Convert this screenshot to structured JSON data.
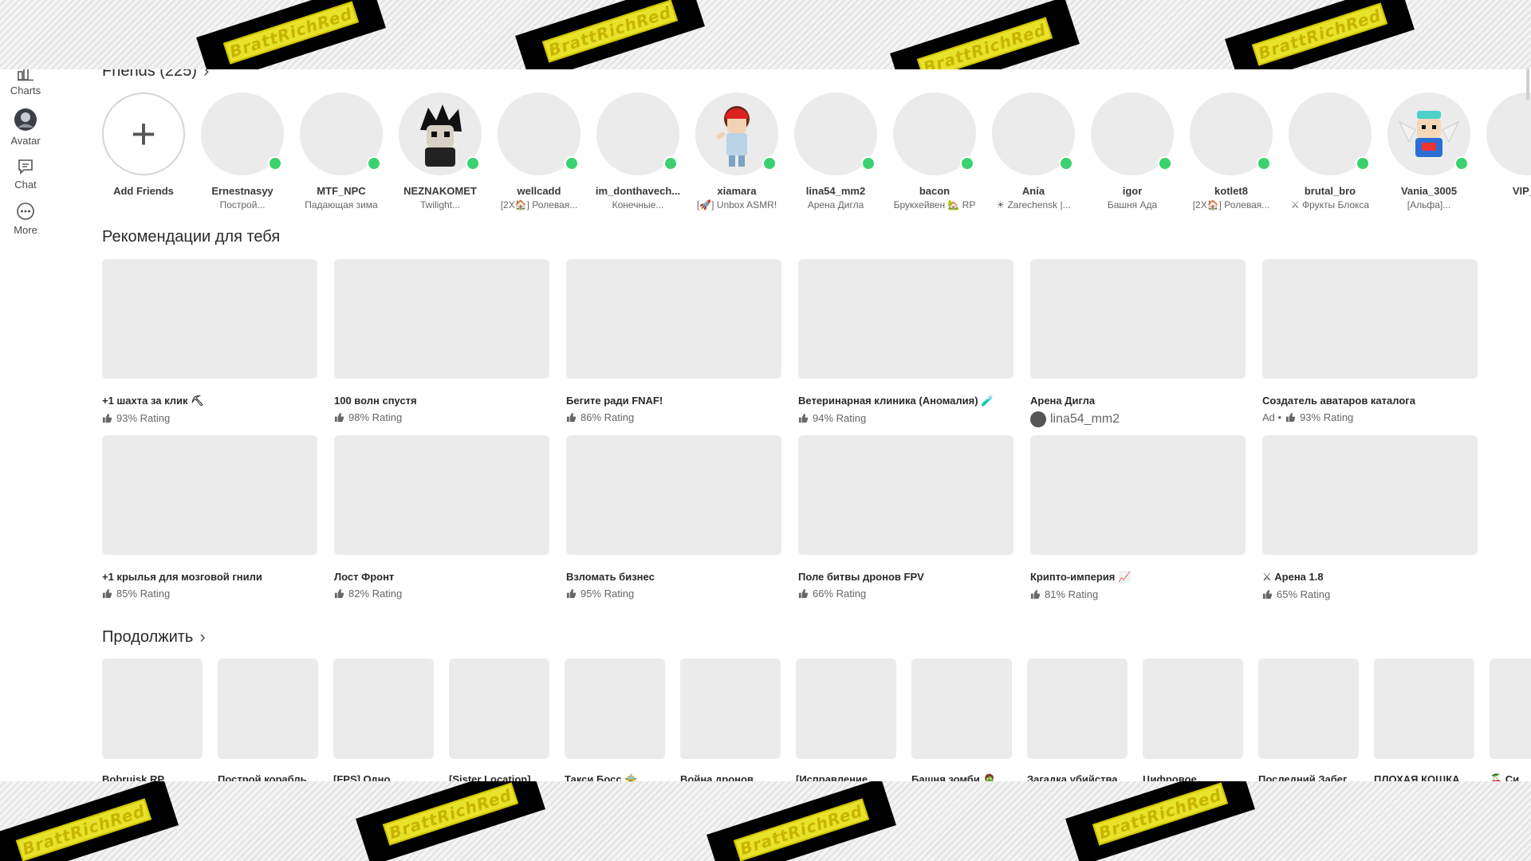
{
  "sidebar": {
    "items": [
      {
        "label": "Charts",
        "icon": "charts-icon"
      },
      {
        "label": "Avatar",
        "icon": "avatar-icon"
      },
      {
        "label": "Chat",
        "icon": "chat-icon"
      },
      {
        "label": "More",
        "icon": "more-icon"
      }
    ]
  },
  "friends": {
    "title": "Friends (225)",
    "add_label": "Add Friends",
    "list": [
      {
        "name": "Ernestnasyy",
        "status": "Построй..."
      },
      {
        "name": "MTF_NPC",
        "status": "Падающая зима"
      },
      {
        "name": "NEZNAKOMET",
        "status": "Twilight..."
      },
      {
        "name": "wellcadd",
        "status": "[2X🏠] Ролевая..."
      },
      {
        "name": "im_donthavech...",
        "status": "Конечные..."
      },
      {
        "name": "xiamara",
        "status": "[🚀] Unbox ASMR!"
      },
      {
        "name": "lina54_mm2",
        "status": "Арена Дигла"
      },
      {
        "name": "bacon",
        "status": "Брукхейвен 🏡 RP"
      },
      {
        "name": "Ania",
        "status": "☀ Zarechensk |..."
      },
      {
        "name": "igor",
        "status": "Башня Ада"
      },
      {
        "name": "kotlet8",
        "status": "[2X🏠] Ролевая..."
      },
      {
        "name": "brutal_bro",
        "status": "⚔ Фрукты Блокса"
      },
      {
        "name": "Vania_3005",
        "status": "[Альфа]..."
      },
      {
        "name": "VIP_G",
        "status": ""
      }
    ]
  },
  "recommended": {
    "title": "Рекомендации для тебя",
    "rows": [
      [
        {
          "title": "+1 шахта за клик ⛏",
          "rating": "93% Rating"
        },
        {
          "title": "100 волн спустя",
          "rating": "98% Rating"
        },
        {
          "title": "Бегите ради FNAF!",
          "rating": "86% Rating"
        },
        {
          "title": "Ветеринарная клиника (Аномалия) 🧪",
          "rating": "94% Rating"
        },
        {
          "title": "Арена Дигла",
          "creator": "lina54_mm2"
        },
        {
          "title": "Создатель аватаров каталога",
          "ad": "Ad •",
          "rating": "93% Rating"
        }
      ],
      [
        {
          "title": "+1 крылья для мозговой гнили",
          "rating": "85% Rating"
        },
        {
          "title": "Лост Фронт",
          "rating": "82% Rating"
        },
        {
          "title": "Взломать бизнес",
          "rating": "95% Rating"
        },
        {
          "title": "Поле битвы дронов FPV",
          "rating": "66% Rating"
        },
        {
          "title": "Крипто-империя 📈",
          "rating": "81% Rating"
        },
        {
          "title": "⚔ Арена 1.8",
          "rating": "65% Rating"
        }
      ]
    ]
  },
  "continue": {
    "title": "Продолжить",
    "items": [
      "Bobruisk RP",
      "Построй корабль",
      "[FPS] Одно",
      "[Sister Location]",
      "Такси Босс 🚖",
      "Война дронов",
      "[Исправление",
      "Башня зомби 🧟",
      "Загадка убийства",
      "Цифровое",
      "Последний Забег",
      "ПЛОХАЯ КОШКА",
      "🍒 Си"
    ]
  },
  "overlay": {
    "watermark": "BrattRichRed"
  },
  "colors": {
    "online": "#3bd16f",
    "placeholder": "#ebebeb",
    "stripe_yellow": "#e8e22a"
  }
}
